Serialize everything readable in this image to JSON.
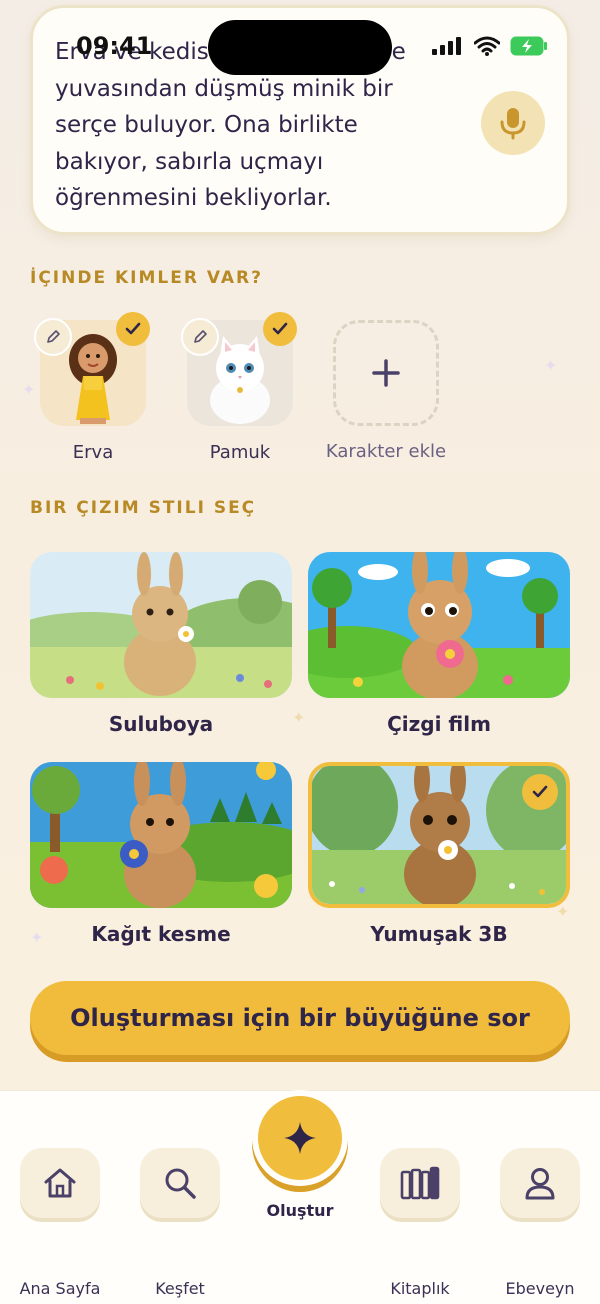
{
  "status_bar": {
    "time": "09:41"
  },
  "story": {
    "text": "Erva ve kedisi Pamuk bahçede yuvasından düşmüş minik bir serçe buluyor. Ona birlikte bakıyor, sabırla uçmayı öğrenmesini bekliyorlar.",
    "mic_icon": "microphone-icon"
  },
  "characters_section": {
    "title": "İÇINDE KIMLER VAR?",
    "characters": [
      {
        "name": "Erva",
        "selected": true
      },
      {
        "name": "Pamuk",
        "selected": true
      }
    ],
    "add_label": "Karakter ekle"
  },
  "style_section": {
    "title": "BIR ÇIZIM STILI SEÇ",
    "styles": [
      {
        "label": "Suluboya",
        "selected": false
      },
      {
        "label": "Çizgi film",
        "selected": false
      },
      {
        "label": "Kağıt kesme",
        "selected": false
      },
      {
        "label": "Yumuşak 3B",
        "selected": true
      }
    ]
  },
  "cta": {
    "label": "Oluşturması için bir büyüğüne sor"
  },
  "tab_bar": {
    "home": "Ana Sayfa",
    "explore": "Keşfet",
    "create": "Oluştur",
    "library": "Kitaplık",
    "parent": "Ebeveyn"
  },
  "colors": {
    "accent": "#f1bd3d",
    "text": "#2e2549",
    "section_title": "#b88a26"
  }
}
